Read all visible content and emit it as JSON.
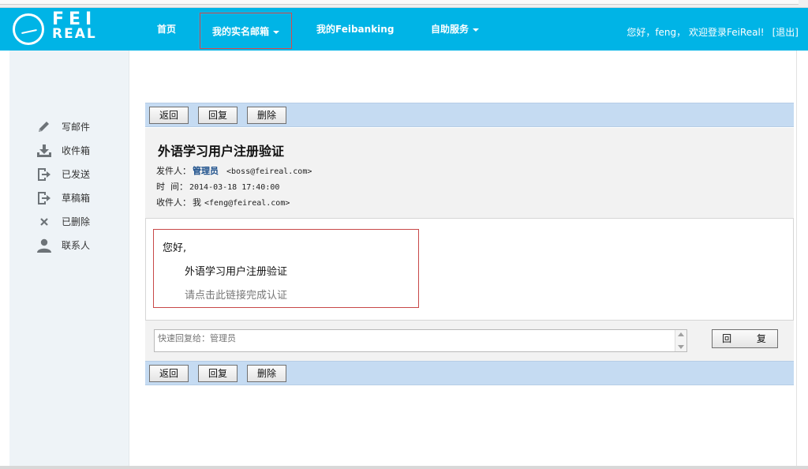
{
  "header": {
    "logo_top": "FEI",
    "logo_bottom": "REAL",
    "nav": {
      "home": "首页",
      "mail": "我的实名邮箱",
      "feibanking": "我的Feibanking",
      "service": "自助服务"
    },
    "greeting": "您好，feng， 欢迎登录FeiReal!",
    "logout": "[退出]",
    "colors": {
      "bar": "#00b4e6",
      "highlight": "#d84a4a"
    }
  },
  "sidebar": {
    "items": [
      {
        "label": "写邮件",
        "icon": "pencil-icon"
      },
      {
        "label": "收件箱",
        "icon": "inbox-download-icon"
      },
      {
        "label": "已发送",
        "icon": "sent-export-icon"
      },
      {
        "label": "草稿箱",
        "icon": "drafts-export-icon"
      },
      {
        "label": "已删除",
        "icon": "close-x-icon"
      },
      {
        "label": "联系人",
        "icon": "person-icon"
      }
    ]
  },
  "toolbar": {
    "back": "返回",
    "reply": "回复",
    "delete": "删除"
  },
  "message": {
    "subject": "外语学习用户注册验证",
    "from_label": "发件人：",
    "from_name": "管理员",
    "from_addr": "<boss@feireal.com>",
    "time_label": "时  间：",
    "time_value": "2014-03-18 17:40:00",
    "to_label": "收件人：",
    "to_name": "我",
    "to_addr": "<feng@feireal.com>",
    "body": {
      "greeting": "您好,",
      "line1": "外语学习用户注册验证",
      "line2": "请点击此链接完成认证"
    }
  },
  "quick_reply": {
    "placeholder": "快速回复给：管理员",
    "button": "回 复"
  }
}
